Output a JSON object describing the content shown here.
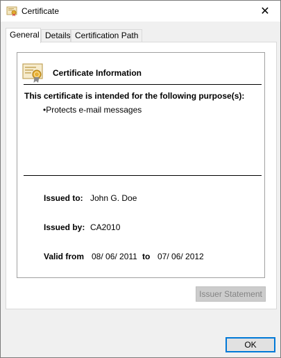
{
  "window": {
    "title": "Certificate"
  },
  "tabs": [
    {
      "label": "General",
      "active": true
    },
    {
      "label": "Details",
      "active": false
    },
    {
      "label": "Certification Path",
      "active": false
    }
  ],
  "general": {
    "heading": "Certificate Information",
    "purpose_heading": "This certificate is intended for the following purpose(s):",
    "purposes": [
      "•Protects e-mail messages"
    ],
    "issued_to_label": "Issued to:",
    "issued_to_value": "John G. Doe",
    "issued_by_label": "Issued by:",
    "issued_by_value": "CA2010",
    "valid_from_label": "Valid from",
    "valid_from_value": "08/ 06/ 2011",
    "valid_to_label": "to",
    "valid_to_value": "07/ 06/ 2012"
  },
  "buttons": {
    "issuer_statement": "Issuer Statement",
    "ok": "OK"
  },
  "icons": {
    "title": "certificate-icon",
    "close": "close-icon",
    "info": "certificate-icon"
  },
  "colors": {
    "accent": "#0078d7",
    "panel": "#ffffff",
    "background": "#f0f0f0"
  }
}
